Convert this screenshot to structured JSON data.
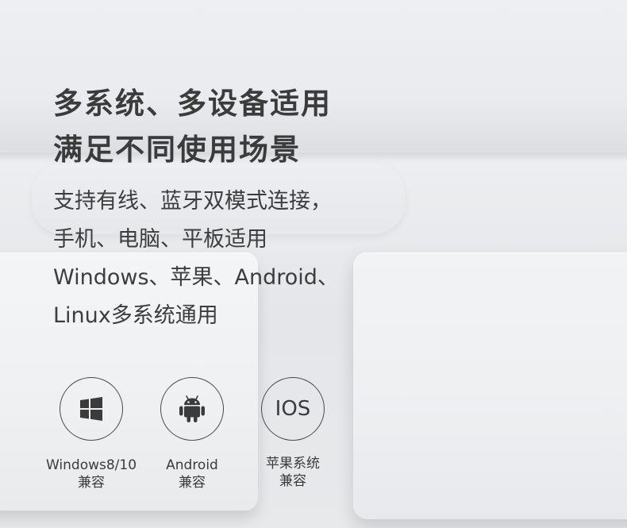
{
  "headline": {
    "line1": "多系统、多设备适用",
    "line2": "满足不同使用场景"
  },
  "description": {
    "line1": "支持有线、蓝牙双模式连接，",
    "line2": "手机、电脑、平板适用",
    "line3": "Windows、苹果、Android、",
    "line4": "Linux多系统通用"
  },
  "compatibility": [
    {
      "icon": "windows-logo-icon",
      "label_line1": "Windows8/10",
      "label_line2": "兼容"
    },
    {
      "icon": "android-logo-icon",
      "label_line1": "Android",
      "label_line2": "兼容"
    },
    {
      "icon": "ios-text-icon",
      "icon_text": "IOS",
      "label_line1": "苹果系统",
      "label_line2": "兼容"
    }
  ],
  "colors": {
    "text": "#3b3b3b",
    "background": "#e9eaec",
    "icon_stroke": "#4a4a4a"
  }
}
